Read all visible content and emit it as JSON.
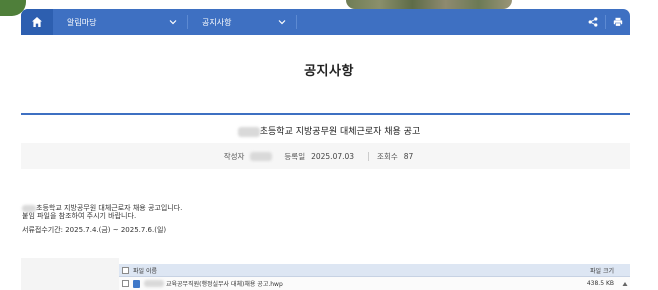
{
  "nav": {
    "menu1": "알림마당",
    "menu2": "공지사항"
  },
  "page": {
    "title": "공지사항"
  },
  "post": {
    "title": "초등학교 지방공무원 대체근로자 채용 공고",
    "author_label": "작성자",
    "date_label": "등록일",
    "date_value": "2025.07.03",
    "views_label": "조회수",
    "views_value": "87",
    "body_line1": "초등학교 지방공무원 대체근로자 채용 공고입니다.",
    "body_line2": "붙임 파일을 참조하여 주시기 바랍니다.",
    "body_line3": "서류접수기간: 2025.7.4.(금) ~ 2025.7.6.(일)"
  },
  "attachments": {
    "header_name": "파일 이름",
    "header_size": "파일 크기",
    "files": [
      {
        "name": "교육공무직원(행정실무사 대체)채용 공고.hwp",
        "size": "438.5 KB"
      }
    ]
  },
  "colors": {
    "nav_bg": "#3e70c2",
    "home_bg": "#2d5fb0",
    "accent_rule": "#3e70c2"
  },
  "icons": {
    "home": "home-icon",
    "dropdown": "chevron-down-icon",
    "share": "share-icon",
    "print": "print-icon",
    "file": "hwp-file-icon"
  }
}
